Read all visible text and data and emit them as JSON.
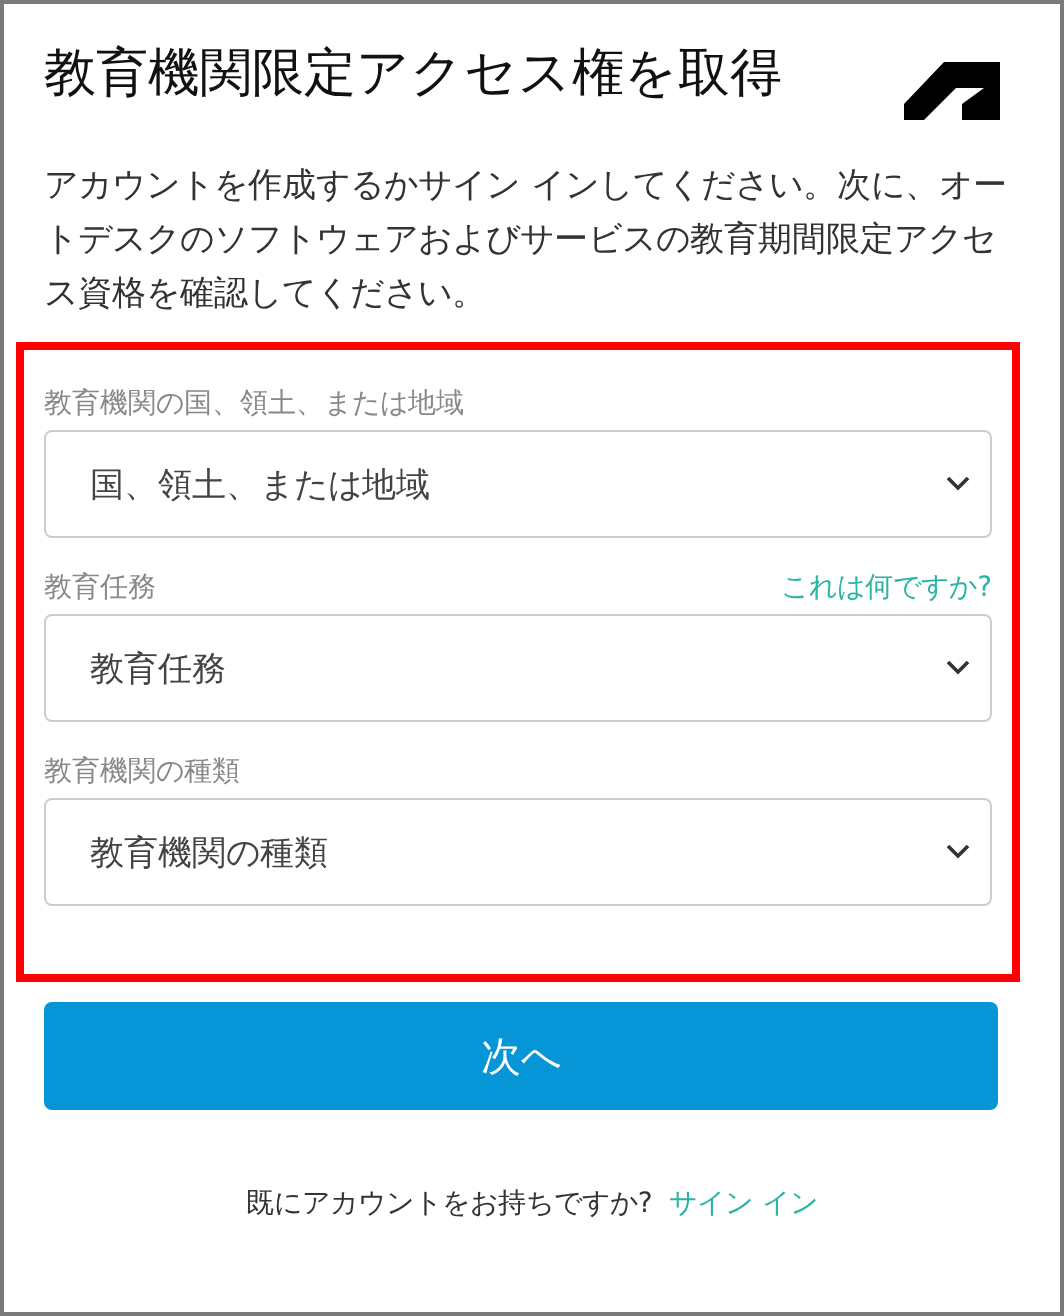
{
  "title": "教育機関限定アクセス権を取得",
  "description": "アカウントを作成するかサイン インしてください。次に、オートデスクのソフトウェアおよびサービスの教育期間限定アクセス資格を確認してください。",
  "fields": [
    {
      "label": "教育機関の国、領土、または地域",
      "value": "国、領土、または地域"
    },
    {
      "label": "教育任務",
      "value": "教育任務",
      "help_link": "これは何ですか?"
    },
    {
      "label": "教育機関の種類",
      "value": "教育機関の種類"
    }
  ],
  "next_button": "次へ",
  "footer": {
    "text": "既にアカウントをお持ちですか?",
    "link": "サイン イン"
  }
}
